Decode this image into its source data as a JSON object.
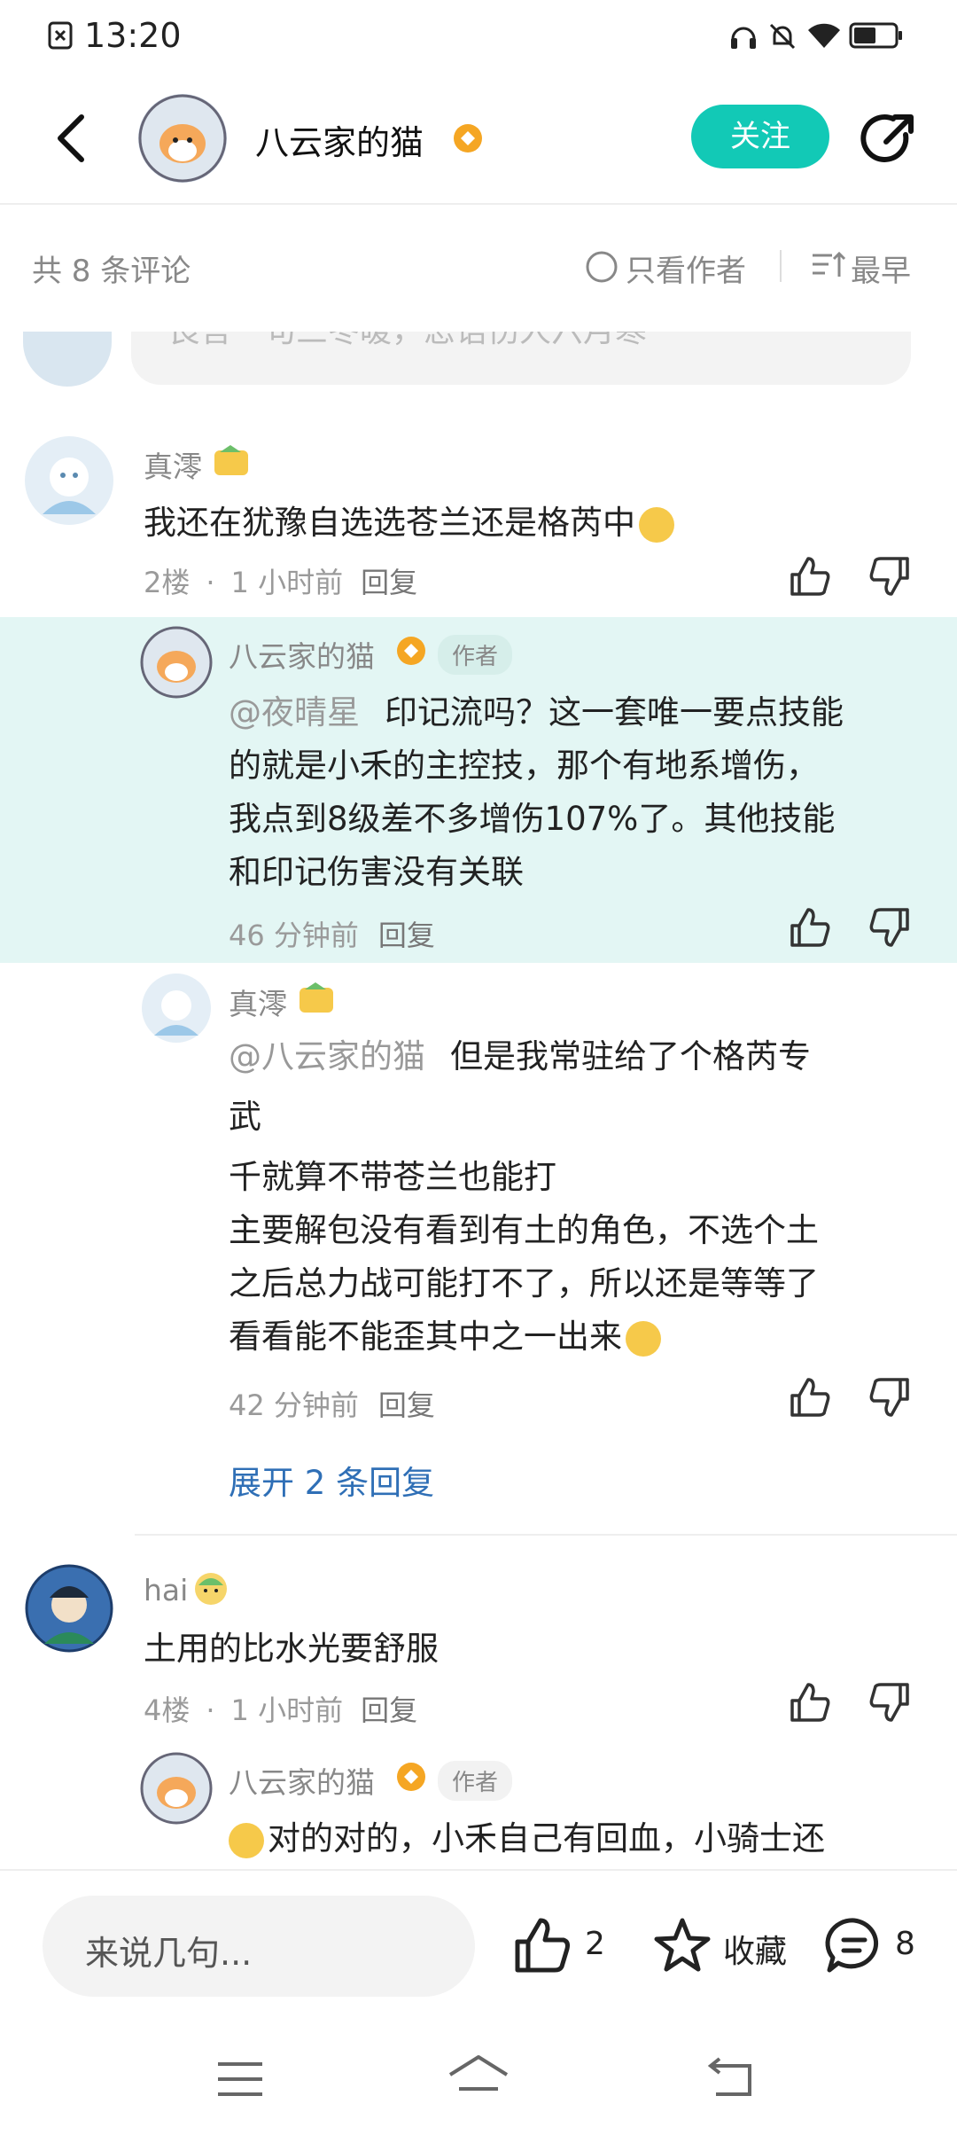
{
  "status_bar": {
    "time": "13:20"
  },
  "header": {
    "author_name": "八云家的猫",
    "follow_label": "关注"
  },
  "subheader": {
    "count_label": "共 8 条评论",
    "only_author_label": "只看作者",
    "sort_label": "最早"
  },
  "top_partial_comment": {
    "text": "良言一句三冬暖，恶语伤人六月寒"
  },
  "comments": [
    {
      "username": "真澪",
      "content": "我还在犹豫自选选苍兰还是格芮中",
      "floor": "2楼",
      "time": "1 小时前",
      "reply_label": "回复",
      "replies": [
        {
          "username": "八云家的猫",
          "author_tag": "作者",
          "mention": "@夜晴星",
          "lines": [
            "印记流吗？这一套唯一要点技能",
            "的就是小禾的主控技，那个有地系增伤，",
            "我点到8级差不多增伤107%了。其他技能",
            "和印记伤害没有关联"
          ],
          "time": "46 分钟前",
          "reply_label": "回复"
        },
        {
          "username": "真澪",
          "mention": "@八云家的猫",
          "lines": [
            "但是我常驻给了个格芮专",
            "武",
            "千就算不带苍兰也能打",
            "主要解包没有看到有土的角色，不选个土",
            "之后总力战可能打不了，所以还是等等了",
            "看看能不能歪其中之一出来"
          ],
          "time": "42 分钟前",
          "reply_label": "回复"
        }
      ],
      "expand_label": "展开 2 条回复"
    },
    {
      "username": "hai",
      "content": "土用的比水光要舒服",
      "floor": "4楼",
      "time": "1 小时前",
      "reply_label": "回复",
      "replies": [
        {
          "username": "八云家的猫",
          "author_tag": "作者",
          "lines": [
            "对的对的，小禾自己有回血，小骑士还"
          ]
        }
      ]
    }
  ],
  "bottom_bar": {
    "input_placeholder": "来说几句...",
    "like_count": "2",
    "favorite_label": "收藏",
    "comment_count": "8"
  },
  "colors": {
    "accent": "#12c9b6",
    "highlight_bg": "#e3f6f4",
    "link": "#2f6fb6"
  }
}
